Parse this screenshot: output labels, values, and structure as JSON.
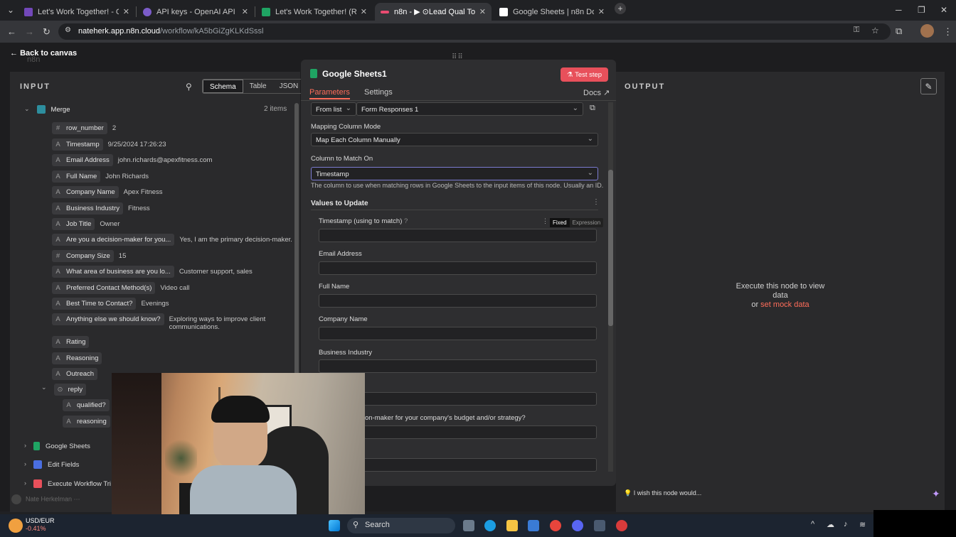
{
  "browser": {
    "tabs": [
      {
        "title": "Let's Work Together! - Google",
        "color": "#7248b9"
      },
      {
        "title": "API keys - OpenAI API",
        "color": "#7b5cc9"
      },
      {
        "title": "Let's Work Together! (Response",
        "color": "#1fa463"
      },
      {
        "title": "n8n - ▶ ⊙Lead Qual Tool",
        "color": "#ea4b71"
      },
      {
        "title": "Google Sheets | n8n Docs",
        "color": "#ffffff"
      }
    ],
    "url_host": "nateherk.app.n8n.cloud",
    "url_path": "/workflow/kA5bGiZgKLKdSssl"
  },
  "app": {
    "back_label": "Back to canvas",
    "logo_text": "n8n",
    "input_title": "INPUT",
    "output_title": "OUTPUT",
    "view_tabs": [
      "Schema",
      "Table",
      "JSON"
    ],
    "merge_label": "Merge",
    "items_count": "2 items",
    "fields": [
      {
        "type": "#",
        "name": "row_number",
        "value": "2"
      },
      {
        "type": "A",
        "name": "Timestamp",
        "value": "9/25/2024 17:26:23"
      },
      {
        "type": "A",
        "name": "Email Address",
        "value": "john.richards@apexfitness.com"
      },
      {
        "type": "A",
        "name": "Full Name",
        "value": "John Richards"
      },
      {
        "type": "A",
        "name": "Company Name",
        "value": "Apex Fitness"
      },
      {
        "type": "A",
        "name": "Business Industry",
        "value": "Fitness"
      },
      {
        "type": "A",
        "name": "Job Title",
        "value": "Owner"
      },
      {
        "type": "A",
        "name": "Are you a decision-maker for you...",
        "value": "Yes, I am the primary decision-maker."
      },
      {
        "type": "#",
        "name": "Company Size",
        "value": "15"
      },
      {
        "type": "A",
        "name": "What area of business are you lo...",
        "value": "Customer support, sales"
      },
      {
        "type": "A",
        "name": "Preferred Contact Method(s)",
        "value": "Video call"
      },
      {
        "type": "A",
        "name": "Best Time to Contact?",
        "value": "Evenings"
      },
      {
        "type": "A",
        "name": "Anything else we should know?",
        "value": "Exploring ways to improve client",
        "value2": "communications."
      },
      {
        "type": "A",
        "name": "Rating",
        "value": ""
      },
      {
        "type": "A",
        "name": "Reasoning",
        "value": ""
      },
      {
        "type": "A",
        "name": "Outreach",
        "value": ""
      }
    ],
    "reply_label": "reply",
    "reply_fields": [
      {
        "type": "A",
        "name": "qualified?"
      },
      {
        "type": "A",
        "name": "reasoning"
      }
    ],
    "other_nodes": [
      "Google Sheets",
      "Edit Fields",
      "Execute Workflow Tri"
    ],
    "user_name": "Nate Herkelman",
    "execute_msg": "Execute this node to view data",
    "or_text": "or",
    "mock_link": "set mock data",
    "wish_text": "I wish this node would..."
  },
  "modal": {
    "title": "Google Sheets1",
    "test_step": "Test step",
    "tabs": [
      "Parameters",
      "Settings"
    ],
    "docs": "Docs",
    "sheet_mode": "From list",
    "sheet_value": "Form Responses 1",
    "mapping_label": "Mapping Column Mode",
    "mapping_value": "Map Each Column Manually",
    "match_label": "Column to Match On",
    "match_value": "Timestamp",
    "match_hint": "The column to use when matching rows in Google Sheets to the input items of this node. Usually an ID.",
    "values_label": "Values to Update",
    "ts_label": "Timestamp (using to match)",
    "fixed": "Fixed",
    "expression": "Expression",
    "field_labels": [
      "Email Address",
      "Full Name",
      "Company Name",
      "Business Industry"
    ],
    "partial_label": "on-maker for your company's budget and/or strategy?"
  },
  "taskbar": {
    "ticker_pair": "USD/EUR",
    "ticker_change": "-0.41%",
    "search": "Search"
  }
}
